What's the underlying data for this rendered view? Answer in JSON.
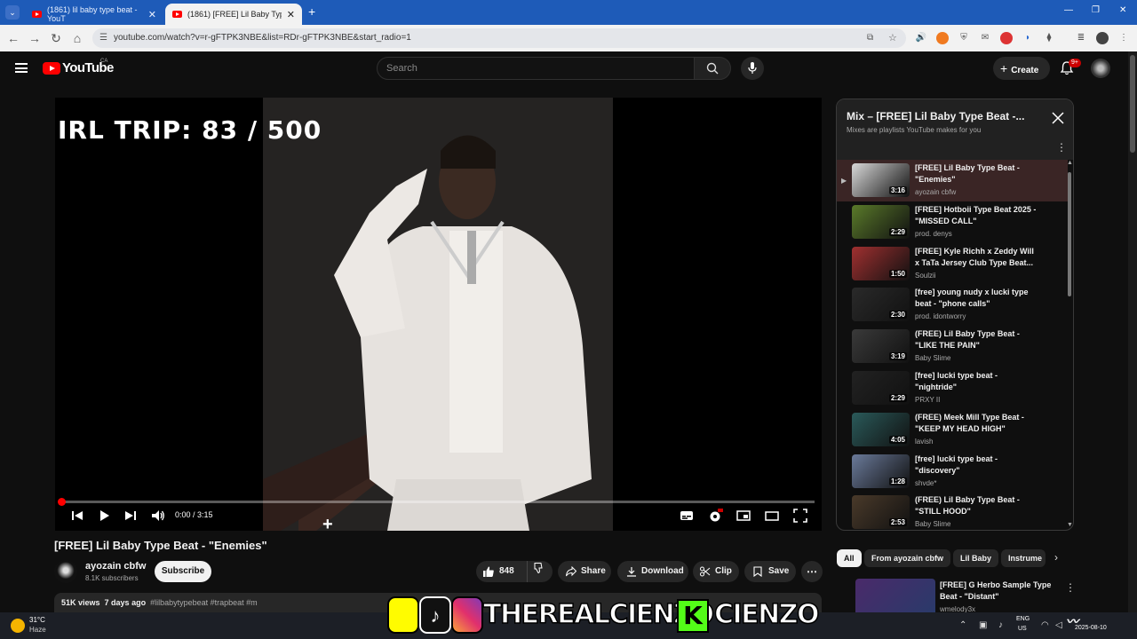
{
  "browser": {
    "tabs": [
      {
        "label": "(1861) lil baby type beat - YouT",
        "active": false
      },
      {
        "label": "(1861) [FREE] Lil Baby Type Beat",
        "active": true
      }
    ],
    "new_tab": "+",
    "url": "youtube.com/watch?v=r-gFTPK3NBE&list=RDr-gFTPK3NBE&start_radio=1"
  },
  "header": {
    "logo_text": "YouTube",
    "country": "CA",
    "search_placeholder": "Search",
    "create_label": "Create",
    "notif_badge": "9+"
  },
  "player": {
    "overlay_text": "IRL TRIP:  83 / 500",
    "time": "0:00 / 3:15",
    "progress_fraction": 0.0
  },
  "video": {
    "title": "[FREE] Lil Baby Type Beat - \"Enemies\"",
    "channel": "ayozain cbfw",
    "subscribers": "8.1K subscribers",
    "subscribe_label": "Subscribe",
    "likes": "848",
    "share_label": "Share",
    "download_label": "Download",
    "clip_label": "Clip",
    "save_label": "Save",
    "views": "51K views",
    "age": "7 days ago",
    "tags": "#lilbabytypebeat #trapbeat #m"
  },
  "playlist": {
    "title": "Mix – [FREE] Lil Baby Type Beat -...",
    "subtitle": "Mixes are playlists YouTube makes for you",
    "items": [
      {
        "title": "[FREE] Lil Baby Type Beat - \"Enemies\"",
        "channel": "ayozain cbfw",
        "duration": "3:16",
        "current": true,
        "thumb": "#d8d8d8"
      },
      {
        "title": "[FREE] Hotboii Type Beat 2025 - \"MISSED CALL\"",
        "channel": "prod. denys",
        "duration": "2:29",
        "current": false,
        "thumb": "#5a7a2a"
      },
      {
        "title": "[FREE] Kyle Richh x Zeddy Will x TaTa Jersey Club Type Beat...",
        "channel": "Soulzii",
        "duration": "1:50",
        "current": false,
        "thumb": "#a03030"
      },
      {
        "title": "[free] young nudy x lucki type beat - \"phone calls\"",
        "channel": "prod. idontworry",
        "duration": "2:30",
        "current": false,
        "thumb": "#2a2a2a"
      },
      {
        "title": "(FREE) Lil Baby Type Beat - \"LIKE THE PAIN\"",
        "channel": "Baby Slime",
        "duration": "3:19",
        "current": false,
        "thumb": "#3a3a3a"
      },
      {
        "title": "[free] lucki type beat - \"nightride\"",
        "channel": "PRXY II",
        "duration": "2:29",
        "current": false,
        "thumb": "#222"
      },
      {
        "title": "(FREE) Meek Mill Type Beat - \"KEEP MY HEAD HIGH\"",
        "channel": "lavish",
        "duration": "4:05",
        "current": false,
        "thumb": "#2a5a5a"
      },
      {
        "title": "[free] lucki type beat - \"discovery\"",
        "channel": "shvde*",
        "duration": "1:28",
        "current": false,
        "thumb": "#6a7a9a"
      },
      {
        "title": "(FREE) Lil Baby Type Beat - \"STILL HOOD\"",
        "channel": "Baby Slime",
        "duration": "2:53",
        "current": false,
        "thumb": "#4a3a2a"
      }
    ]
  },
  "chips": [
    "All",
    "From ayozain cbfw",
    "Lil Baby",
    "Instrume"
  ],
  "recommendation": {
    "title": "[FREE] G Herbo Sample Type Beat - \"Distant\"",
    "channel": "wmelody3x"
  },
  "watermark": {
    "text1": "THEREALCIENZO",
    "text2": "CIENZO"
  },
  "taskbar": {
    "temp": "31°C",
    "weather": "Haze",
    "lang1": "ENG",
    "lang2": "US",
    "date": "2025-08-10"
  },
  "colors": {
    "accent": "#ff0000",
    "chrome_blue": "#1e5bb8"
  }
}
